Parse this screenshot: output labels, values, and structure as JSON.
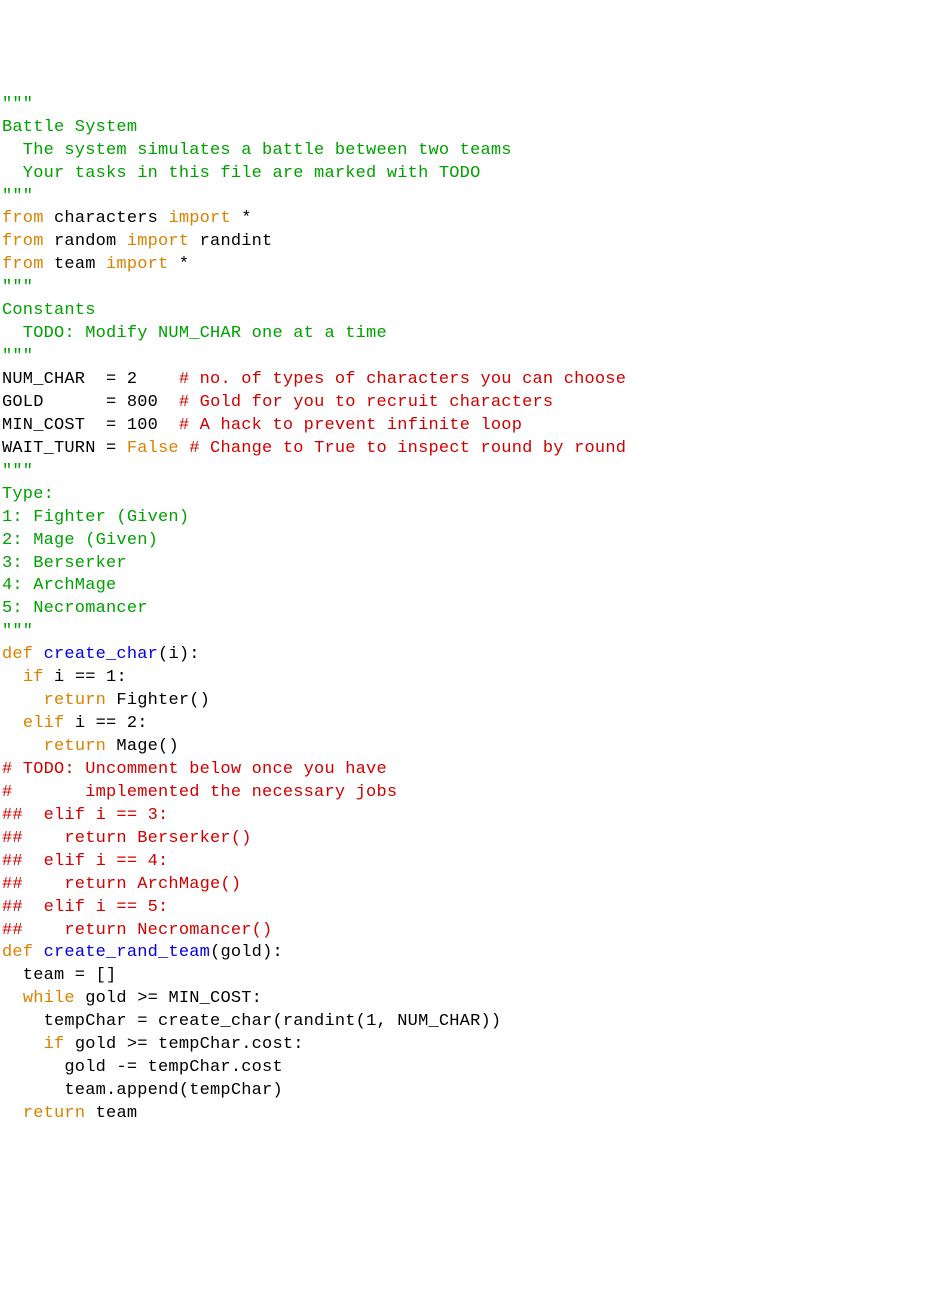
{
  "lines": [
    {
      "spans": [
        {
          "cls": "green",
          "t": "\"\"\""
        }
      ]
    },
    {
      "spans": [
        {
          "cls": "green",
          "t": "Battle System"
        }
      ]
    },
    {
      "spans": [
        {
          "cls": "green",
          "t": "  The system simulates a battle between two teams"
        }
      ]
    },
    {
      "spans": [
        {
          "cls": "green",
          "t": "  Your tasks in this file are marked with TODO"
        }
      ]
    },
    {
      "spans": [
        {
          "cls": "green",
          "t": "\"\"\""
        }
      ]
    },
    {
      "spans": [
        {
          "cls": "orange",
          "t": "from"
        },
        {
          "cls": "default",
          "t": " characters "
        },
        {
          "cls": "orange",
          "t": "import"
        },
        {
          "cls": "default",
          "t": " *"
        }
      ]
    },
    {
      "spans": [
        {
          "cls": "orange",
          "t": "from"
        },
        {
          "cls": "default",
          "t": " random "
        },
        {
          "cls": "orange",
          "t": "import"
        },
        {
          "cls": "default",
          "t": " randint"
        }
      ]
    },
    {
      "spans": [
        {
          "cls": "orange",
          "t": "from"
        },
        {
          "cls": "default",
          "t": " team "
        },
        {
          "cls": "orange",
          "t": "import"
        },
        {
          "cls": "default",
          "t": " *"
        }
      ]
    },
    {
      "spans": [
        {
          "cls": "default",
          "t": ""
        }
      ]
    },
    {
      "spans": [
        {
          "cls": "green",
          "t": "\"\"\""
        }
      ]
    },
    {
      "spans": [
        {
          "cls": "green",
          "t": "Constants"
        }
      ]
    },
    {
      "spans": [
        {
          "cls": "green",
          "t": "  TODO: Modify NUM_CHAR one at a time"
        }
      ]
    },
    {
      "spans": [
        {
          "cls": "green",
          "t": "\"\"\""
        }
      ]
    },
    {
      "spans": [
        {
          "cls": "default",
          "t": "NUM_CHAR  = "
        },
        {
          "cls": "default",
          "t": "2"
        },
        {
          "cls": "default",
          "t": "    "
        },
        {
          "cls": "red",
          "t": "# no. of types of characters you can choose"
        }
      ]
    },
    {
      "spans": [
        {
          "cls": "default",
          "t": "GOLD      = "
        },
        {
          "cls": "default",
          "t": "800"
        },
        {
          "cls": "default",
          "t": "  "
        },
        {
          "cls": "red",
          "t": "# Gold for you to recruit characters"
        }
      ]
    },
    {
      "spans": [
        {
          "cls": "default",
          "t": "MIN_COST  = "
        },
        {
          "cls": "default",
          "t": "100"
        },
        {
          "cls": "default",
          "t": "  "
        },
        {
          "cls": "red",
          "t": "# A hack to prevent infinite loop"
        }
      ]
    },
    {
      "spans": [
        {
          "cls": "default",
          "t": "WAIT_TURN = "
        },
        {
          "cls": "orange",
          "t": "False"
        },
        {
          "cls": "default",
          "t": " "
        },
        {
          "cls": "red",
          "t": "# Change to True to inspect round by round"
        }
      ]
    },
    {
      "spans": [
        {
          "cls": "default",
          "t": ""
        }
      ]
    },
    {
      "spans": [
        {
          "cls": "green",
          "t": "\"\"\""
        }
      ]
    },
    {
      "spans": [
        {
          "cls": "green",
          "t": "Type:"
        }
      ]
    },
    {
      "spans": [
        {
          "cls": "green",
          "t": "1: Fighter (Given)"
        }
      ]
    },
    {
      "spans": [
        {
          "cls": "green",
          "t": "2: Mage (Given)"
        }
      ]
    },
    {
      "spans": [
        {
          "cls": "green",
          "t": "3: Berserker"
        }
      ]
    },
    {
      "spans": [
        {
          "cls": "green",
          "t": "4: ArchMage"
        }
      ]
    },
    {
      "spans": [
        {
          "cls": "green",
          "t": "5: Necromancer"
        }
      ]
    },
    {
      "spans": [
        {
          "cls": "green",
          "t": "\"\"\""
        }
      ]
    },
    {
      "spans": [
        {
          "cls": "default",
          "t": ""
        }
      ]
    },
    {
      "spans": [
        {
          "cls": "orange",
          "t": "def"
        },
        {
          "cls": "default",
          "t": " "
        },
        {
          "cls": "blue",
          "t": "create_char"
        },
        {
          "cls": "default",
          "t": "(i):"
        }
      ]
    },
    {
      "spans": [
        {
          "cls": "default",
          "t": "  "
        },
        {
          "cls": "orange",
          "t": "if"
        },
        {
          "cls": "default",
          "t": " i == "
        },
        {
          "cls": "default",
          "t": "1"
        },
        {
          "cls": "default",
          "t": ":"
        }
      ]
    },
    {
      "spans": [
        {
          "cls": "default",
          "t": "    "
        },
        {
          "cls": "orange",
          "t": "return"
        },
        {
          "cls": "default",
          "t": " Fighter()"
        }
      ]
    },
    {
      "spans": [
        {
          "cls": "default",
          "t": "  "
        },
        {
          "cls": "orange",
          "t": "elif"
        },
        {
          "cls": "default",
          "t": " i == "
        },
        {
          "cls": "default",
          "t": "2"
        },
        {
          "cls": "default",
          "t": ":"
        }
      ]
    },
    {
      "spans": [
        {
          "cls": "default",
          "t": "    "
        },
        {
          "cls": "orange",
          "t": "return"
        },
        {
          "cls": "default",
          "t": " Mage()"
        }
      ]
    },
    {
      "spans": [
        {
          "cls": "red",
          "t": "# TODO: Uncomment below once you have"
        }
      ]
    },
    {
      "spans": [
        {
          "cls": "red",
          "t": "#       implemented the necessary jobs"
        }
      ]
    },
    {
      "spans": [
        {
          "cls": "red",
          "t": "##  elif i == 3:"
        }
      ]
    },
    {
      "spans": [
        {
          "cls": "red",
          "t": "##    return Berserker()"
        }
      ]
    },
    {
      "spans": [
        {
          "cls": "red",
          "t": "##  elif i == 4:"
        }
      ]
    },
    {
      "spans": [
        {
          "cls": "red",
          "t": "##    return ArchMage()"
        }
      ]
    },
    {
      "spans": [
        {
          "cls": "red",
          "t": "##  elif i == 5:"
        }
      ]
    },
    {
      "spans": [
        {
          "cls": "red",
          "t": "##    return Necromancer()"
        }
      ]
    },
    {
      "spans": [
        {
          "cls": "default",
          "t": ""
        }
      ]
    },
    {
      "spans": [
        {
          "cls": "default",
          "t": ""
        }
      ]
    },
    {
      "spans": [
        {
          "cls": "orange",
          "t": "def"
        },
        {
          "cls": "default",
          "t": " "
        },
        {
          "cls": "blue",
          "t": "create_rand_team"
        },
        {
          "cls": "default",
          "t": "(gold):"
        }
      ]
    },
    {
      "spans": [
        {
          "cls": "default",
          "t": "  team = []"
        }
      ]
    },
    {
      "spans": [
        {
          "cls": "default",
          "t": "  "
        },
        {
          "cls": "orange",
          "t": "while"
        },
        {
          "cls": "default",
          "t": " gold >= MIN_COST:"
        }
      ]
    },
    {
      "spans": [
        {
          "cls": "default",
          "t": "    tempChar = create_char(randint("
        },
        {
          "cls": "default",
          "t": "1"
        },
        {
          "cls": "default",
          "t": ", NUM_CHAR))"
        }
      ]
    },
    {
      "spans": [
        {
          "cls": "default",
          "t": "    "
        },
        {
          "cls": "orange",
          "t": "if"
        },
        {
          "cls": "default",
          "t": " gold >= tempChar.cost:"
        }
      ]
    },
    {
      "spans": [
        {
          "cls": "default",
          "t": "      gold -= tempChar.cost"
        }
      ]
    },
    {
      "spans": [
        {
          "cls": "default",
          "t": "      team.append(tempChar)"
        }
      ]
    },
    {
      "spans": [
        {
          "cls": "default",
          "t": "  "
        },
        {
          "cls": "orange",
          "t": "return"
        },
        {
          "cls": "default",
          "t": " team"
        }
      ]
    }
  ]
}
